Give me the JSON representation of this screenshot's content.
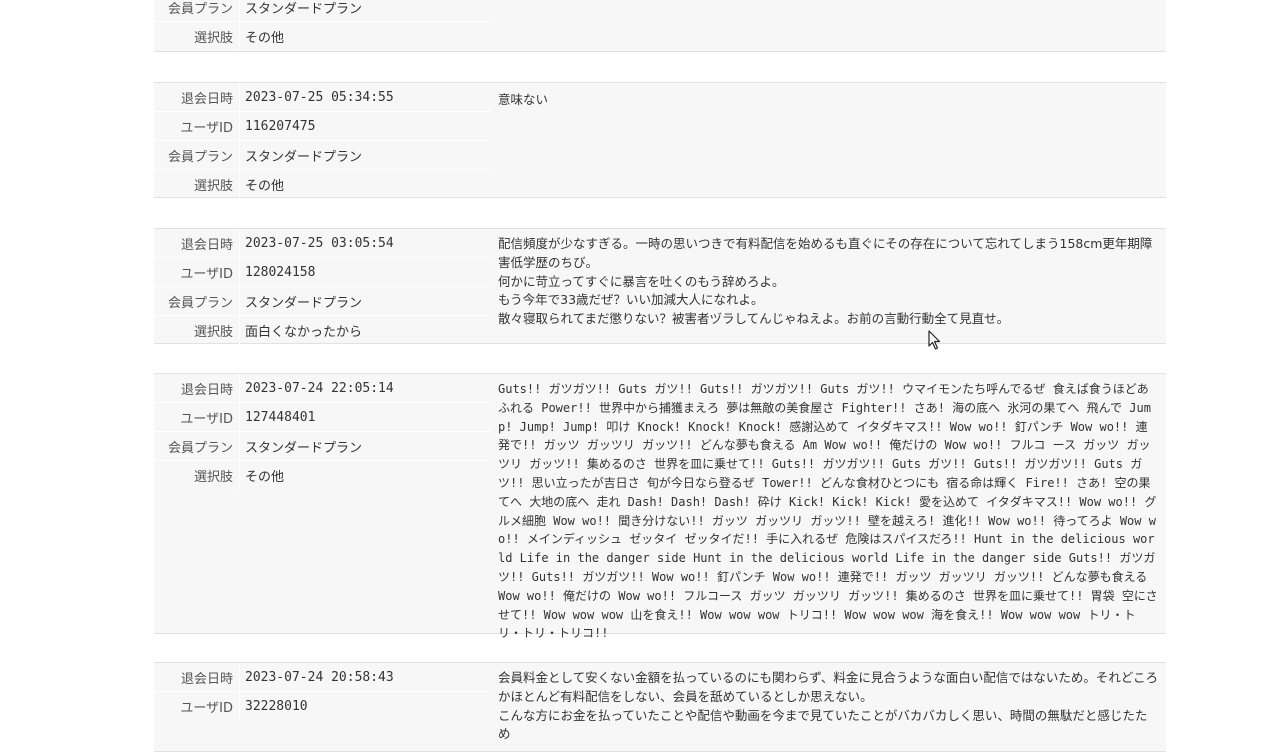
{
  "labels": {
    "withdrawal_datetime": "退会日時",
    "user_id": "ユーザID",
    "plan": "会員プラン",
    "choice": "選択肢"
  },
  "records": [
    {
      "plan": "スタンダードプラン",
      "choice": "その他"
    },
    {
      "datetime": "2023-07-25 05:34:55",
      "user_id": "116207475",
      "plan": "スタンダードプラン",
      "choice": "その他",
      "comment": "意味ない"
    },
    {
      "datetime": "2023-07-25 03:05:54",
      "user_id": "128024158",
      "plan": "スタンダードプラン",
      "choice": "面白くなかったから",
      "comment": "配信頻度が少なすぎる。一時の思いつきで有料配信を始めるも直ぐにその存在について忘れてしまう158cm更年期障害低学歴のちび。\n何かに苛立ってすぐに暴言を吐くのもう辞めろよ。\nもう今年で33歳だぜ？いい加減大人になれよ。\n散々寝取られてまだ懲りない？被害者ヅラしてんじゃねえよ。お前の言動行動全て見直せ。"
    },
    {
      "datetime": "2023-07-24 22:05:14",
      "user_id": "127448401",
      "plan": "スタンダードプラン",
      "choice": "その他",
      "comment": "Guts!! ガツガツ!! Guts ガツ!! Guts!! ガツガツ!! Guts ガツ!! ウマイモンたち呼んでるぜ 食えば食うほどあふれる Power!! 世界中から捕獲まえろ 夢は無敵の美食屋さ Fighter!! さあ! 海の底へ 氷河の果てへ 飛んで Jump! Jump! Jump! 叩け Knock! Knock! Knock! 感謝込めて イタダキマス!! Wow wo!! 釘パンチ Wow wo!! 連発で!! ガッツ ガッツリ ガッツ!! どんな夢も食える Am Wow wo!! 俺だけの Wow wo!! フルコ ース ガッツ ガッツリ ガッツ!! 集めるのさ 世界を皿に乗せて!! Guts!! ガツガツ!! Guts ガツ!! Guts!! ガツガツ!! Guts ガツ!! 思い立ったが吉日さ 旬が今日なら登るぜ Tower!! どんな食材ひとつにも 宿る命は輝く Fire!! さあ! 空の果てへ 大地の底へ 走れ Dash! Dash! Dash! 砕け Kick! Kick! Kick! 愛を込めて イタダキマス!! Wow wo!! グルメ細胞 Wow wo!! 聞き分けない!! ガッツ ガッツリ ガッツ!! 壁を越えろ! 進化!! Wow wo!! 待ってろよ Wow wo!! メインディッシュ ゼッタイ ゼッタイだ!! 手に入れるぜ 危険はスパイスだろ!! Hunt in the delicious world Life in the danger side Hunt in the delicious world Life in the danger side Guts!! ガツガツ!! Guts!! ガツガツ!! Wow wo!! 釘パンチ Wow wo!! 連発で!! ガッツ ガッツリ ガッツ!! どんな夢も食える Wow wo!! 俺だけの Wow wo!! フルコース ガッツ ガッツリ ガッツ!! 集めるのさ 世界を皿に乗せて!! 胃袋 空にさせて!! Wow wow wow 山を食え!! Wow wow wow トリコ!! Wow wow wow 海を食え!! Wow wow wow トリ・トリ・トリ・トリコ!!"
    },
    {
      "datetime": "2023-07-24 20:58:43",
      "user_id": "32228010",
      "comment": "会員料金として安くない金額を払っているのにも関わらず、料金に見合うような面白い配信ではないため。それどころかほとんど有料配信をしない、会員を舐めているとしか思えない。\nこんな方にお金を払っていたことや配信や動画を今まで見ていたことがバカバカしく思い、時間の無駄だと感じたため"
    }
  ]
}
